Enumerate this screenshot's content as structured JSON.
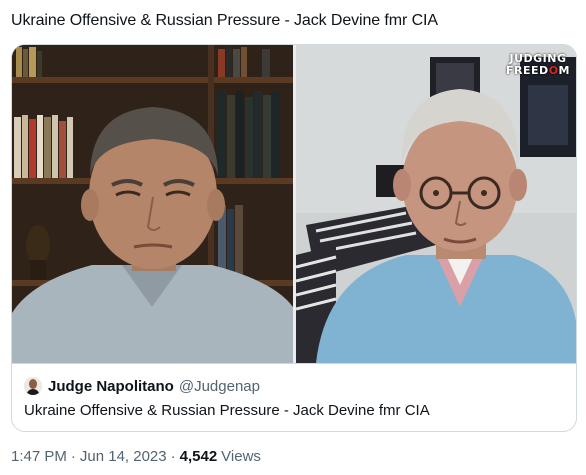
{
  "tweet": {
    "text": "Ukraine Offensive & Russian Pressure - Jack Devine fmr CIA"
  },
  "video": {
    "logo_line1": "JUDGING",
    "logo_line2_a": "FREED",
    "logo_line2_b": "O",
    "logo_line2_c": "M"
  },
  "source": {
    "name": "Judge Napolitano",
    "handle": "@Judgenap",
    "title": "Ukraine Offensive & Russian Pressure - Jack Devine fmr CIA"
  },
  "meta": {
    "time": "1:47 PM",
    "date": "Jun 14, 2023",
    "views_count": "4,542",
    "views_label": "Views"
  },
  "colors": {
    "border": "#cfd9de",
    "secondary_text": "#536471",
    "logo_accent": "#d9251c"
  }
}
